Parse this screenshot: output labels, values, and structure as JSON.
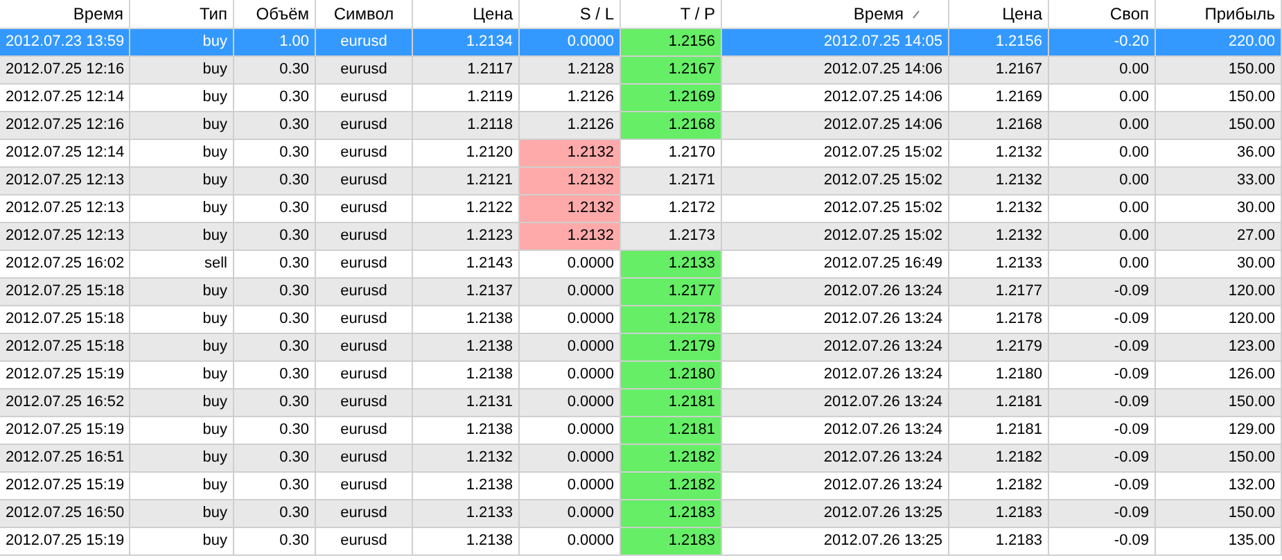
{
  "columns": [
    {
      "label": "Время",
      "sorted": false
    },
    {
      "label": "Тип",
      "sorted": false
    },
    {
      "label": "Объём",
      "sorted": false
    },
    {
      "label": "Символ",
      "sorted": false
    },
    {
      "label": "Цена",
      "sorted": false
    },
    {
      "label": "S / L",
      "sorted": false
    },
    {
      "label": "T / P",
      "sorted": false
    },
    {
      "label": "Время",
      "sorted": true
    },
    {
      "label": "Цена",
      "sorted": false
    },
    {
      "label": "Своп",
      "sorted": false
    },
    {
      "label": "Прибыль",
      "sorted": false
    }
  ],
  "rows": [
    {
      "selected": true,
      "sl_hit": false,
      "tp_hit": true,
      "cells": [
        "2012.07.23 13:59",
        "buy",
        "1.00",
        "eurusd",
        "1.2134",
        "0.0000",
        "1.2156",
        "2012.07.25 14:05",
        "1.2156",
        "-0.20",
        "220.00"
      ]
    },
    {
      "selected": false,
      "sl_hit": false,
      "tp_hit": true,
      "cells": [
        "2012.07.25 12:16",
        "buy",
        "0.30",
        "eurusd",
        "1.2117",
        "1.2128",
        "1.2167",
        "2012.07.25 14:06",
        "1.2167",
        "0.00",
        "150.00"
      ]
    },
    {
      "selected": false,
      "sl_hit": false,
      "tp_hit": true,
      "cells": [
        "2012.07.25 12:14",
        "buy",
        "0.30",
        "eurusd",
        "1.2119",
        "1.2126",
        "1.2169",
        "2012.07.25 14:06",
        "1.2169",
        "0.00",
        "150.00"
      ]
    },
    {
      "selected": false,
      "sl_hit": false,
      "tp_hit": true,
      "cells": [
        "2012.07.25 12:16",
        "buy",
        "0.30",
        "eurusd",
        "1.2118",
        "1.2126",
        "1.2168",
        "2012.07.25 14:06",
        "1.2168",
        "0.00",
        "150.00"
      ]
    },
    {
      "selected": false,
      "sl_hit": true,
      "tp_hit": false,
      "cells": [
        "2012.07.25 12:14",
        "buy",
        "0.30",
        "eurusd",
        "1.2120",
        "1.2132",
        "1.2170",
        "2012.07.25 15:02",
        "1.2132",
        "0.00",
        "36.00"
      ]
    },
    {
      "selected": false,
      "sl_hit": true,
      "tp_hit": false,
      "cells": [
        "2012.07.25 12:13",
        "buy",
        "0.30",
        "eurusd",
        "1.2121",
        "1.2132",
        "1.2171",
        "2012.07.25 15:02",
        "1.2132",
        "0.00",
        "33.00"
      ]
    },
    {
      "selected": false,
      "sl_hit": true,
      "tp_hit": false,
      "cells": [
        "2012.07.25 12:13",
        "buy",
        "0.30",
        "eurusd",
        "1.2122",
        "1.2132",
        "1.2172",
        "2012.07.25 15:02",
        "1.2132",
        "0.00",
        "30.00"
      ]
    },
    {
      "selected": false,
      "sl_hit": true,
      "tp_hit": false,
      "cells": [
        "2012.07.25 12:13",
        "buy",
        "0.30",
        "eurusd",
        "1.2123",
        "1.2132",
        "1.2173",
        "2012.07.25 15:02",
        "1.2132",
        "0.00",
        "27.00"
      ]
    },
    {
      "selected": false,
      "sl_hit": false,
      "tp_hit": true,
      "cells": [
        "2012.07.25 16:02",
        "sell",
        "0.30",
        "eurusd",
        "1.2143",
        "0.0000",
        "1.2133",
        "2012.07.25 16:49",
        "1.2133",
        "0.00",
        "30.00"
      ]
    },
    {
      "selected": false,
      "sl_hit": false,
      "tp_hit": true,
      "cells": [
        "2012.07.25 15:18",
        "buy",
        "0.30",
        "eurusd",
        "1.2137",
        "0.0000",
        "1.2177",
        "2012.07.26 13:24",
        "1.2177",
        "-0.09",
        "120.00"
      ]
    },
    {
      "selected": false,
      "sl_hit": false,
      "tp_hit": true,
      "cells": [
        "2012.07.25 15:18",
        "buy",
        "0.30",
        "eurusd",
        "1.2138",
        "0.0000",
        "1.2178",
        "2012.07.26 13:24",
        "1.2178",
        "-0.09",
        "120.00"
      ]
    },
    {
      "selected": false,
      "sl_hit": false,
      "tp_hit": true,
      "cells": [
        "2012.07.25 15:18",
        "buy",
        "0.30",
        "eurusd",
        "1.2138",
        "0.0000",
        "1.2179",
        "2012.07.26 13:24",
        "1.2179",
        "-0.09",
        "123.00"
      ]
    },
    {
      "selected": false,
      "sl_hit": false,
      "tp_hit": true,
      "cells": [
        "2012.07.25 15:19",
        "buy",
        "0.30",
        "eurusd",
        "1.2138",
        "0.0000",
        "1.2180",
        "2012.07.26 13:24",
        "1.2180",
        "-0.09",
        "126.00"
      ]
    },
    {
      "selected": false,
      "sl_hit": false,
      "tp_hit": true,
      "cells": [
        "2012.07.25 16:52",
        "buy",
        "0.30",
        "eurusd",
        "1.2131",
        "0.0000",
        "1.2181",
        "2012.07.26 13:24",
        "1.2181",
        "-0.09",
        "150.00"
      ]
    },
    {
      "selected": false,
      "sl_hit": false,
      "tp_hit": true,
      "cells": [
        "2012.07.25 15:19",
        "buy",
        "0.30",
        "eurusd",
        "1.2138",
        "0.0000",
        "1.2181",
        "2012.07.26 13:24",
        "1.2181",
        "-0.09",
        "129.00"
      ]
    },
    {
      "selected": false,
      "sl_hit": false,
      "tp_hit": true,
      "cells": [
        "2012.07.25 16:51",
        "buy",
        "0.30",
        "eurusd",
        "1.2132",
        "0.0000",
        "1.2182",
        "2012.07.26 13:24",
        "1.2182",
        "-0.09",
        "150.00"
      ]
    },
    {
      "selected": false,
      "sl_hit": false,
      "tp_hit": true,
      "cells": [
        "2012.07.25 15:19",
        "buy",
        "0.30",
        "eurusd",
        "1.2138",
        "0.0000",
        "1.2182",
        "2012.07.26 13:24",
        "1.2182",
        "-0.09",
        "132.00"
      ]
    },
    {
      "selected": false,
      "sl_hit": false,
      "tp_hit": true,
      "cells": [
        "2012.07.25 16:50",
        "buy",
        "0.30",
        "eurusd",
        "1.2133",
        "0.0000",
        "1.2183",
        "2012.07.26 13:25",
        "1.2183",
        "-0.09",
        "150.00"
      ]
    },
    {
      "selected": false,
      "sl_hit": false,
      "tp_hit": true,
      "cells": [
        "2012.07.25 15:19",
        "buy",
        "0.30",
        "eurusd",
        "1.2138",
        "0.0000",
        "1.2183",
        "2012.07.26 13:25",
        "1.2183",
        "-0.09",
        "135.00"
      ]
    }
  ]
}
